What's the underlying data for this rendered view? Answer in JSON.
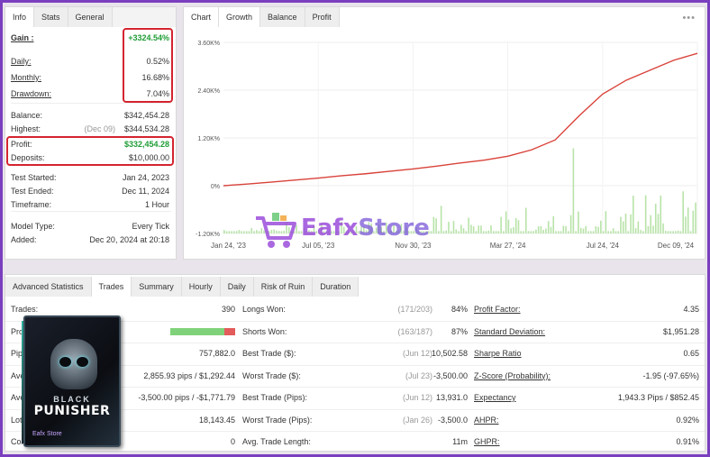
{
  "info_panel": {
    "tabs": [
      "Info",
      "Stats",
      "General"
    ],
    "rows": [
      {
        "label": "Gain :",
        "value": "+3324.54%",
        "value_green": true
      },
      {
        "label": "Daily:",
        "value": "0.52%"
      },
      {
        "label": "Monthly:",
        "value": "16.68%"
      },
      {
        "label": "Drawdown:",
        "value": "7.04%"
      },
      {
        "label": "Balance:",
        "value": "$342,454.28"
      },
      {
        "label": "Highest:",
        "value": "$344,534.28",
        "note": "(Dec 09)"
      },
      {
        "label": "Profit:",
        "value": "$332,454.28",
        "value_green": true
      },
      {
        "label": "Deposits:",
        "value": "$10,000.00"
      },
      {
        "label": "Test Started:",
        "value": "Jan 24, 2023"
      },
      {
        "label": "Test Ended:",
        "value": "Dec 11, 2024"
      },
      {
        "label": "Timeframe:",
        "value": "1 Hour"
      },
      {
        "label": "Model Type:",
        "value": "Every Tick"
      },
      {
        "label": "Added:",
        "value": "Dec 20, 2024 at 20:18"
      }
    ]
  },
  "chart_panel": {
    "tabs": [
      "Chart",
      "Growth",
      "Balance",
      "Profit"
    ],
    "menu_icon": "more-dots-icon"
  },
  "chart_data": {
    "type": "line",
    "y_ticks": [
      "3.60K%",
      "2.40K%",
      "1.20K%",
      "0%",
      "-1.20K%"
    ],
    "x_ticks": [
      "Jan 24, '23",
      "Jul 05, '23",
      "Nov 30, '23",
      "Mar 27, '24",
      "Jul 24, '24",
      "Dec 09, '24"
    ],
    "ylim": [
      -1200,
      3600
    ],
    "growth_line": {
      "color": "#d9423a",
      "x": [
        0,
        0.05,
        0.1,
        0.15,
        0.2,
        0.25,
        0.3,
        0.35,
        0.4,
        0.45,
        0.5,
        0.55,
        0.6,
        0.65,
        0.7,
        0.75,
        0.8,
        0.85,
        0.9,
        0.95,
        1.0
      ],
      "values": [
        0,
        40,
        90,
        140,
        190,
        250,
        300,
        360,
        420,
        490,
        570,
        640,
        740,
        900,
        1150,
        1750,
        2300,
        2650,
        2900,
        3150,
        3324
      ]
    },
    "bars_color": "#b8e3a8"
  },
  "stats_panel": {
    "tabs": [
      "Advanced Statistics",
      "Trades",
      "Summary",
      "Hourly",
      "Daily",
      "Risk of Ruin",
      "Duration"
    ],
    "col1": [
      {
        "label": "Trades:",
        "value": "390"
      },
      {
        "label": "Profitability:",
        "value": ""
      },
      {
        "label": "Pips:",
        "value": "757,882.0"
      },
      {
        "label": "Average Win:",
        "value": "2,855.93 pips / $1,292.44"
      },
      {
        "label": "Average Loss:",
        "value": "-3,500.00 pips / -$1,771.79"
      },
      {
        "label": "Lots:",
        "value": "18,143.45"
      },
      {
        "label": "Commissions:",
        "value": "0"
      }
    ],
    "profitability_bar": {
      "win_fraction": 0.84,
      "win_color": "#7fd27a",
      "loss_color": "#e35b5b"
    },
    "col2": [
      {
        "label": "Longs Won:",
        "note": "(171/203)",
        "value": "84%"
      },
      {
        "label": "Shorts Won:",
        "note": "(163/187)",
        "value": "87%"
      },
      {
        "label": "Best Trade ($):",
        "note": "(Jun 12)",
        "value": "10,502.58"
      },
      {
        "label": "Worst Trade ($):",
        "note": "(Jul 23)",
        "value": "-3,500.00"
      },
      {
        "label": "Best Trade (Pips):",
        "note": "(Jun 12)",
        "value": "13,931.0"
      },
      {
        "label": "Worst Trade (Pips):",
        "note": "(Jan 26)",
        "value": "-3,500.0"
      },
      {
        "label": "Avg. Trade Length:",
        "note": "",
        "value": "11m"
      }
    ],
    "col3": [
      {
        "label": "Profit Factor:",
        "value": "4.35"
      },
      {
        "label": "Standard Deviation:",
        "value": "$1,951.28"
      },
      {
        "label": "Sharpe Ratio",
        "value": "0.65"
      },
      {
        "label": "Z-Score (Probability):",
        "value": "-1.95 (-97.65%)"
      },
      {
        "label": "Expectancy",
        "value": "1,943.3 Pips / $852.45"
      },
      {
        "label": "AHPR:",
        "value": "0.92%"
      },
      {
        "label": "GHPR:",
        "value": "0.91%"
      }
    ]
  },
  "watermark": {
    "part1": "Eafx",
    "part2": "Store",
    "icon": "shopping-cart-icon"
  },
  "product_box": {
    "line1": "BLACK",
    "line2": "PUNISHER",
    "brand": "Eafx Store",
    "icon": "skull-icon"
  }
}
